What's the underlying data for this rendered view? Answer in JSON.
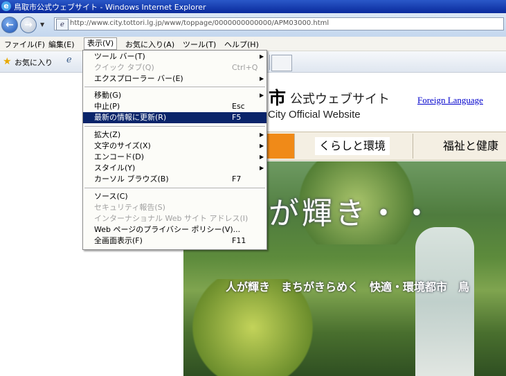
{
  "window": {
    "title": "鳥取市公式ウェブサイト - Windows Internet Explorer"
  },
  "address": {
    "url": "http://www.city.tottori.lg.jp/www/toppage/0000000000000/APM03000.html"
  },
  "menubar": [
    "ファイル(F)",
    "編集(E)",
    "表示(V)",
    "お気に入り(A)",
    "ツール(T)",
    "ヘルプ(H)"
  ],
  "favorites": {
    "label": "お気に入り"
  },
  "view_menu": {
    "items": [
      {
        "label": "ツール バー(T)",
        "shortcut": "",
        "submenu": true,
        "disabled": false
      },
      {
        "label": "クイック タブ(Q)",
        "shortcut": "Ctrl+Q",
        "submenu": false,
        "disabled": true
      },
      {
        "label": "エクスプローラー バー(E)",
        "shortcut": "",
        "submenu": true,
        "disabled": false
      },
      {
        "label": "移動(G)",
        "shortcut": "",
        "submenu": true,
        "disabled": false
      },
      {
        "label": "中止(P)",
        "shortcut": "Esc",
        "submenu": false,
        "disabled": false
      },
      {
        "label": "最新の情報に更新(R)",
        "shortcut": "F5",
        "submenu": false,
        "disabled": false,
        "selected": true
      },
      {
        "label": "拡大(Z)",
        "shortcut": "",
        "submenu": true,
        "disabled": false
      },
      {
        "label": "文字のサイズ(X)",
        "shortcut": "",
        "submenu": true,
        "disabled": false
      },
      {
        "label": "エンコード(D)",
        "shortcut": "",
        "submenu": true,
        "disabled": false
      },
      {
        "label": "スタイル(Y)",
        "shortcut": "",
        "submenu": true,
        "disabled": false
      },
      {
        "label": "カーソル ブラウズ(B)",
        "shortcut": "F7",
        "submenu": false,
        "disabled": false
      },
      {
        "label": "ソース(C)",
        "shortcut": "",
        "submenu": false,
        "disabled": false
      },
      {
        "label": "セキュリティ報告(S)",
        "shortcut": "",
        "submenu": false,
        "disabled": true
      },
      {
        "label": "インターナショナル Web サイト アドレス(I)",
        "shortcut": "",
        "submenu": false,
        "disabled": true
      },
      {
        "label": "Web ページのプライバシー ポリシー(V)...",
        "shortcut": "",
        "submenu": false,
        "disabled": false
      },
      {
        "label": "全画面表示(F)",
        "shortcut": "F11",
        "submenu": false,
        "disabled": false
      }
    ]
  },
  "page": {
    "header_kanji": "市",
    "header_jp": "公式ウェブサイト",
    "header_en": "City Official Website",
    "foreign_link": "Foreign Language",
    "nav": [
      "くらしと環境",
      "福祉と健康"
    ],
    "hero_title": "が輝き・・",
    "hero_sub": "人が輝き　まちがきらめく　快適・環境都市　鳥"
  },
  "colors": {
    "selection": "#0a246a",
    "nav_accent": "#f08a18",
    "link": "#0000cc"
  }
}
